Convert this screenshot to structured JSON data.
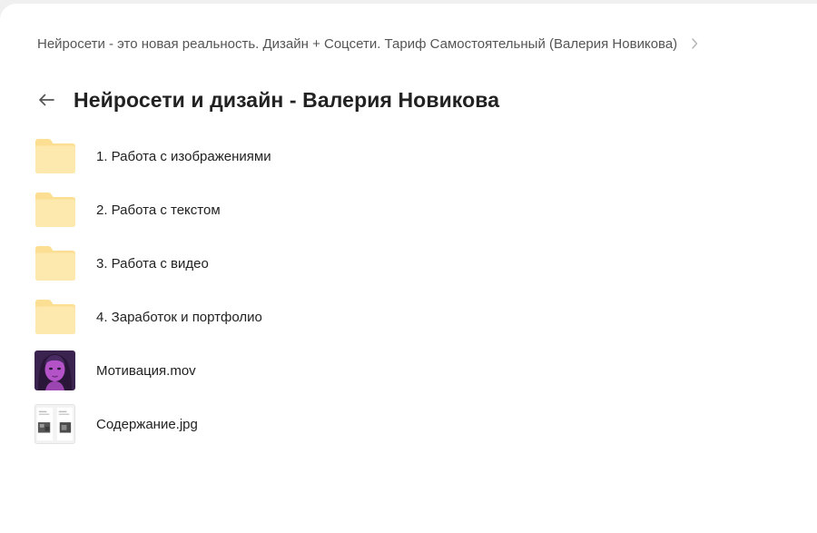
{
  "breadcrumb": {
    "path": "Нейросети - это новая реальность. Дизайн + Соцсети. Тариф Самостоятельный (Валерия Новикова)"
  },
  "header": {
    "title": "Нейросети и дизайн - Валерия Новикова"
  },
  "items": [
    {
      "type": "folder",
      "name": "1. Работа с изображениями"
    },
    {
      "type": "folder",
      "name": "2. Работа с текстом"
    },
    {
      "type": "folder",
      "name": "3. Работа с видео"
    },
    {
      "type": "folder",
      "name": "4. Заработок и портфолио"
    },
    {
      "type": "video",
      "name": "Мотивация.mov"
    },
    {
      "type": "image",
      "name": "Содержание.jpg"
    }
  ],
  "colors": {
    "folder": "#fde7a8",
    "folder_tab": "#fcdf92",
    "video_bg": "#4a2a63",
    "video_face": "#b453c8"
  }
}
